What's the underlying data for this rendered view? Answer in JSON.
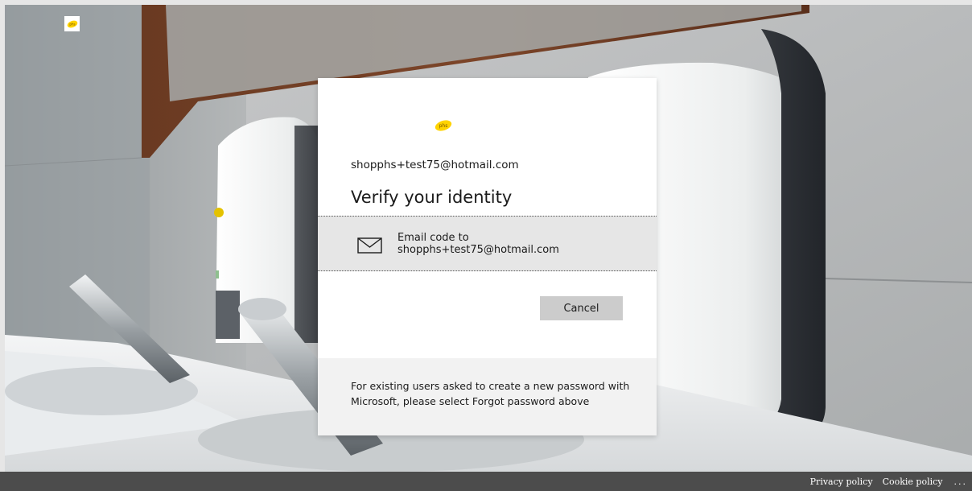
{
  "brand": {
    "logo_text": "phs",
    "accent_color": "#ffd300"
  },
  "card": {
    "account_email": "shopphs+test75@hotmail.com",
    "title": "Verify your identity",
    "option": {
      "icon": "envelope-icon",
      "line1": "Email code to",
      "line2": "shopphs+test75@hotmail.com"
    },
    "cancel_label": "Cancel",
    "footer_note": "For existing users asked to create a new password with Microsoft, please select Forgot password above"
  },
  "footer": {
    "links": [
      "Privacy policy",
      "Cookie policy"
    ],
    "more_label": "..."
  }
}
